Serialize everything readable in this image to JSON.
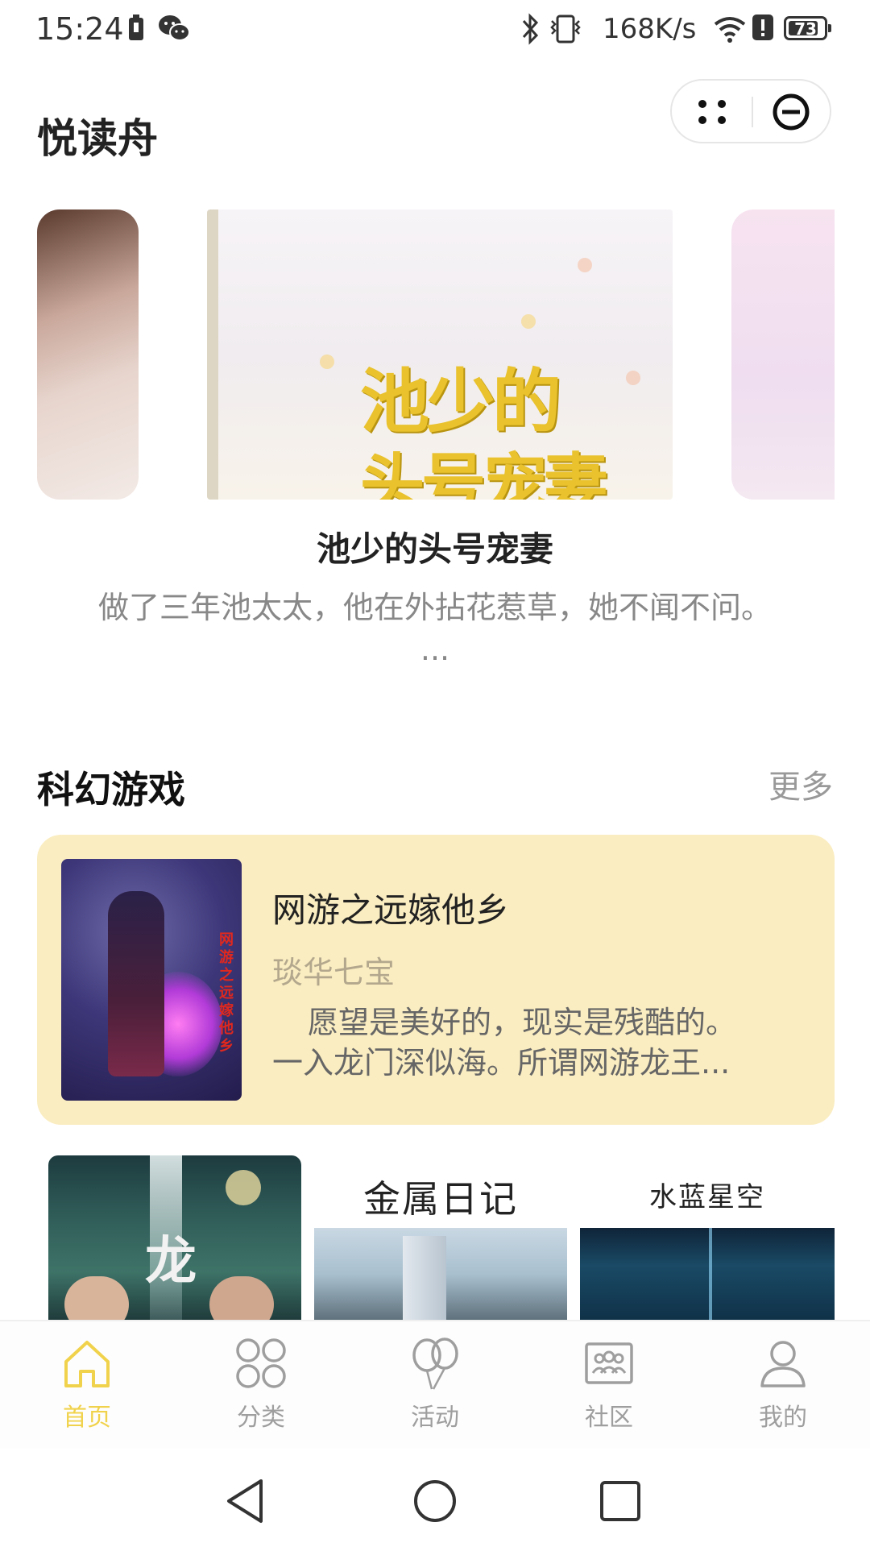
{
  "status_bar": {
    "time": "15:24",
    "network_speed": "168K/s",
    "battery_level": "73"
  },
  "header": {
    "app_title": "悦读舟"
  },
  "banner": {
    "cover_text_line1": "池少的",
    "cover_text_line2": "头号宠妻",
    "book_title": "池少的头号宠妻",
    "book_desc": "做了三年池太太，他在外拈花惹草，她不闻不问。 ..."
  },
  "section": {
    "title": "科幻游戏",
    "more_label": "更多"
  },
  "featured": {
    "cover_vertical_text": "网游之远嫁他乡",
    "name": "网游之远嫁他乡",
    "author": "琰华七宝",
    "desc_line1": "愿望是美好的，现实是残酷的。",
    "desc_line2": "一入龙门深似海。所谓网游龙王..."
  },
  "grid_covers": [
    {
      "cover_text": "龙"
    },
    {
      "cover_text": "金属日记"
    },
    {
      "cover_text": "水蓝星空"
    }
  ],
  "tabbar": {
    "items": [
      {
        "label": "首页",
        "icon": "home-icon",
        "active": true
      },
      {
        "label": "分类",
        "icon": "category-icon",
        "active": false
      },
      {
        "label": "活动",
        "icon": "balloon-icon",
        "active": false
      },
      {
        "label": "社区",
        "icon": "community-icon",
        "active": false
      },
      {
        "label": "我的",
        "icon": "profile-icon",
        "active": false
      }
    ]
  },
  "colors": {
    "accent": "#f1d24c",
    "featured_bg": "#faedc1",
    "inactive_tab": "#9e9e9e"
  }
}
